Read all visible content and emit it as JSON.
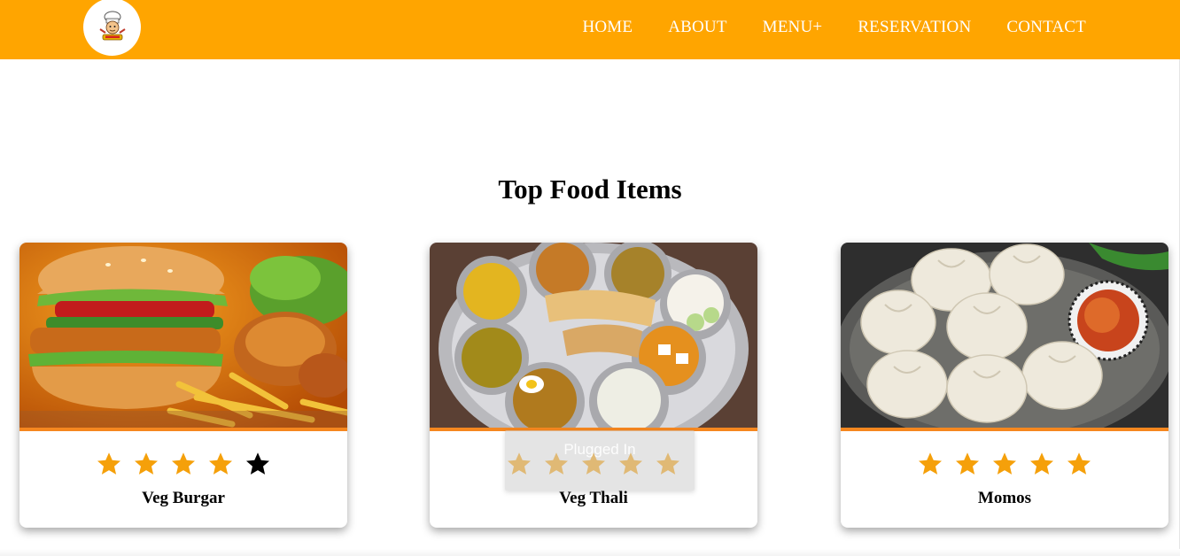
{
  "header": {
    "logo_icon": "chef-logo-icon",
    "nav": [
      "HOME",
      "ABOUT",
      "MENU+",
      "RESERVATION",
      "CONTACT"
    ]
  },
  "section": {
    "title": "Top Food Items"
  },
  "cards": [
    {
      "name": "Veg Burgar",
      "rating": 4,
      "max_rating": 5,
      "image_icon": "burger-image"
    },
    {
      "name": "Veg Thali",
      "rating": 5,
      "max_rating": 5,
      "image_icon": "thali-image"
    },
    {
      "name": "Momos",
      "rating": 5,
      "max_rating": 5,
      "image_icon": "momos-image"
    }
  ],
  "tooltip": {
    "text": "Plugged In"
  },
  "colors": {
    "nav_bg": "#ffa500",
    "star_filled": "#f5a00a",
    "star_empty": "#000000",
    "card_accent": "#f5871f"
  }
}
